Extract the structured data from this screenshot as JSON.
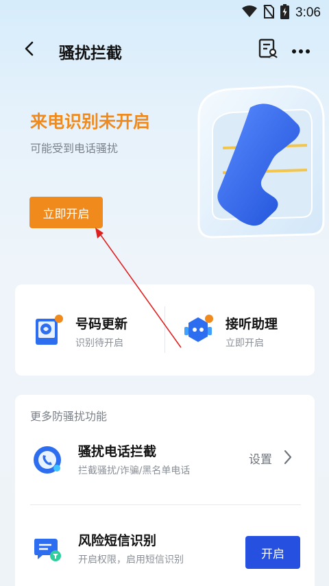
{
  "status_bar": {
    "time": "3:06"
  },
  "nav": {
    "title": "骚扰拦截"
  },
  "hero": {
    "title": "来电识别未开启",
    "subtitle": "可能受到电话骚扰",
    "button_label": "立即开启"
  },
  "quick_actions": [
    {
      "title": "号码更新",
      "subtitle": "识别待开启"
    },
    {
      "title": "接听助理",
      "subtitle": "立即开启"
    }
  ],
  "more_features": {
    "section_title": "更多防骚扰功能",
    "items": [
      {
        "title": "骚扰电话拦截",
        "subtitle": "拦截骚扰/诈骗/黑名单电话",
        "action_label": "设置"
      },
      {
        "title": "风险短信识别",
        "subtitle": "开启权限，启用短信识别",
        "button_label": "开启"
      }
    ]
  },
  "colors": {
    "accent_orange": "#f08a1c",
    "primary_blue": "#2650e0",
    "annotation_red": "#e0201f"
  },
  "icons": [
    "wifi-icon",
    "no-sim-icon",
    "battery-icon",
    "back-icon",
    "report-icon",
    "more-icon",
    "phone-handset-icon",
    "number-update-icon",
    "robot-icon",
    "block-call-icon",
    "sms-shield-icon",
    "chevron-right-icon"
  ]
}
